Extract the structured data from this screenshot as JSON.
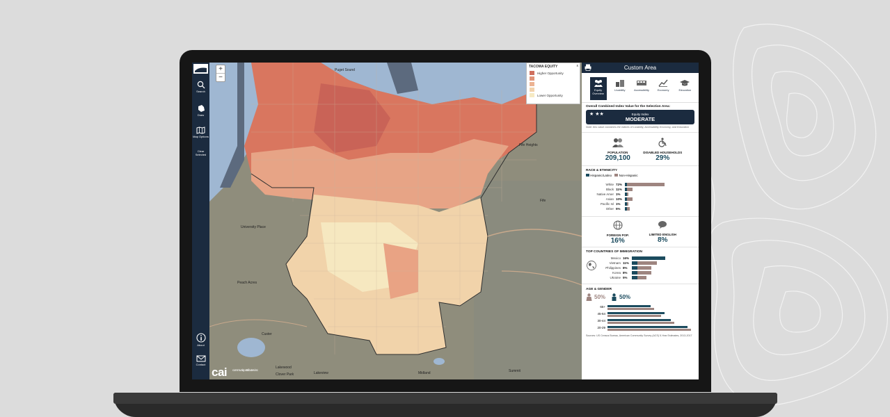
{
  "toolbar": {
    "buttons": [
      {
        "label": "Search",
        "icon": "search-icon"
      },
      {
        "label": "Draw",
        "icon": "draw-icon"
      },
      {
        "label": "Map Options",
        "icon": "map-icon"
      },
      {
        "label": "Clear Selected",
        "icon": "clear-icon"
      }
    ],
    "bottom_buttons": [
      {
        "label": "About",
        "icon": "info-icon"
      },
      {
        "label": "Contact",
        "icon": "mail-icon"
      }
    ]
  },
  "map": {
    "zoom_in": "+",
    "zoom_out": "−",
    "brand": "cai",
    "brand_sub": "community attributes inc",
    "place_labels": [
      {
        "text": "University Place"
      },
      {
        "text": "Peach Acres"
      },
      {
        "text": "Lakewood"
      },
      {
        "text": "Custer"
      },
      {
        "text": "Fife"
      },
      {
        "text": "Fife Heights"
      },
      {
        "text": "Puget Sound"
      },
      {
        "text": "Summit"
      },
      {
        "text": "Midland"
      },
      {
        "text": "Clover Park"
      },
      {
        "text": "Lakeview"
      }
    ],
    "legend": {
      "title": "TACOMA EQUITY",
      "close": "x",
      "items": [
        {
          "label": "Higher Opportunity",
          "color": "#cf6f5e"
        },
        {
          "label": "",
          "color": "#e09379"
        },
        {
          "label": "",
          "color": "#ecb393"
        },
        {
          "label": "",
          "color": "#f2d2ac"
        },
        {
          "label": "Lower Opportunity",
          "color": "#f6eac4"
        }
      ]
    }
  },
  "panel": {
    "title": "Custom Area",
    "tabs": [
      {
        "label": "Equity Overview",
        "icon": "people-icon",
        "active": true
      },
      {
        "label": "Livability",
        "icon": "livability-icon",
        "active": false
      },
      {
        "label": "Accessibility",
        "icon": "bus-icon",
        "active": false
      },
      {
        "label": "Economy",
        "icon": "chart-icon",
        "active": false
      },
      {
        "label": "Education",
        "icon": "graduation-icon",
        "active": false
      }
    ],
    "overall": {
      "heading": "Overall Combined Index Value for the Selection Area:",
      "stars": "★ ★★",
      "index_label": "Equity Index",
      "index_value": "MODERATE",
      "note": "Note: this value combines the indices of Livability, Accessibility Economy, and Education"
    },
    "population": {
      "label": "POPULATION",
      "value": "209,100"
    },
    "disabled": {
      "label": "DISABLED HOUSEHOLDS",
      "value": "29%"
    },
    "race": {
      "heading": "RACE & ETHNICITY",
      "legend": [
        "Hispanic/Latino",
        "Non-Hispanic"
      ],
      "colors": {
        "hispanic": "#1b4b5e",
        "non_hispanic": "#9e8580"
      },
      "rows": [
        {
          "name": "White",
          "pct": "72%",
          "value": 72
        },
        {
          "name": "Black",
          "pct": "11%",
          "value": 11
        },
        {
          "name": "Native Amer",
          "pct": "1%",
          "value": 1
        },
        {
          "name": "Asian",
          "pct": "10%",
          "value": 10
        },
        {
          "name": "Pacific Isl",
          "pct": "1%",
          "value": 1
        },
        {
          "name": "Other",
          "pct": "5%",
          "value": 5
        }
      ]
    },
    "foreign": {
      "label": "FOREIGN POP.",
      "value": "16%"
    },
    "limited_english": {
      "label": "LIMITED ENGLISH",
      "value": "8%"
    },
    "immigration": {
      "heading": "TOP COUNTRIES OF IMMIGRATION",
      "rows": [
        {
          "name": "Mexico",
          "pct": "16%",
          "value": 16
        },
        {
          "name": "Vietnam",
          "pct": "11%",
          "value": 11
        },
        {
          "name": "Philippines",
          "pct": "8%",
          "value": 8
        },
        {
          "name": "Korea",
          "pct": "8%",
          "value": 8
        },
        {
          "name": "Ukraine",
          "pct": "5%",
          "value": 5
        }
      ]
    },
    "age": {
      "heading": "AGE & GENDER",
      "female_pct": "50%",
      "male_pct": "50%",
      "rows": [
        {
          "name": "65+",
          "male": 13,
          "female": 14
        },
        {
          "name": "45-64",
          "male": 17,
          "female": 16
        },
        {
          "name": "30-44",
          "male": 19,
          "female": 20
        },
        {
          "name": "20-29",
          "male": 24,
          "female": 25
        }
      ]
    },
    "source": "Sources: US Census Bureau, American Community Survey (ACS) 5-Year Estimates, 2013-2017"
  }
}
